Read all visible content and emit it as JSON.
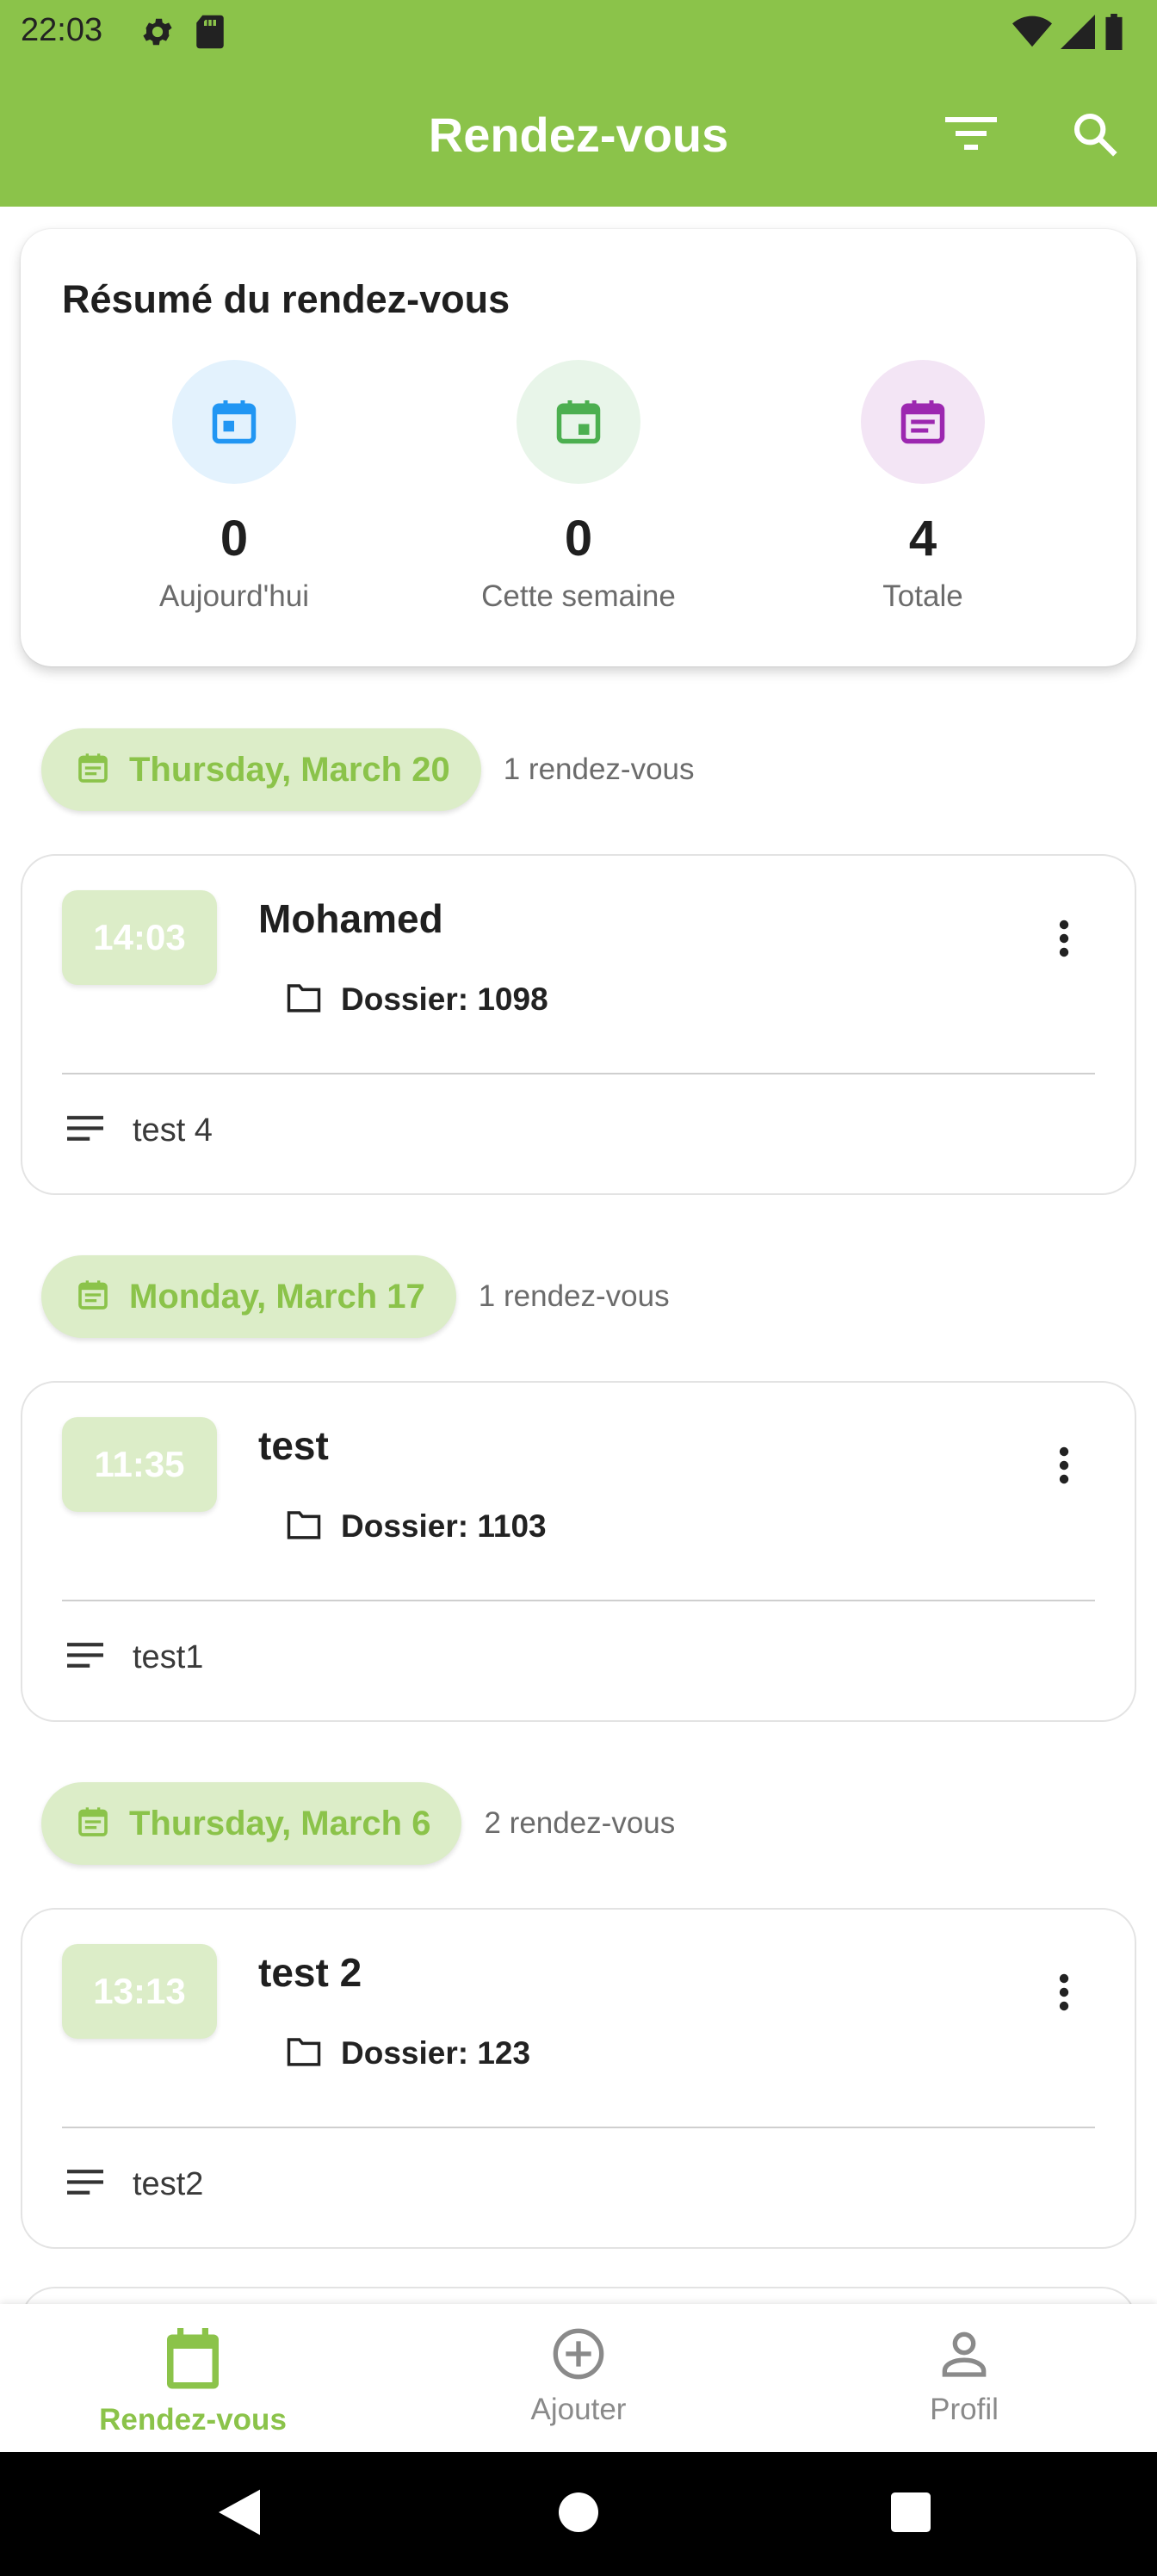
{
  "status_bar": {
    "time": "22:03"
  },
  "app_bar": {
    "title": "Rendez-vous",
    "filter_icon": "filter-icon",
    "search_icon": "search-icon"
  },
  "colors": {
    "primary": "#8bc34a",
    "chip_bg": "#dcedc8",
    "blue": "#2196f3",
    "green": "#4caf50",
    "purple": "#9c27b0"
  },
  "summary": {
    "title": "Résumé du rendez-vous",
    "stats": [
      {
        "value": "0",
        "label": "Aujourd'hui",
        "icon": "calendar-today-icon"
      },
      {
        "value": "0",
        "label": "Cette semaine",
        "icon": "calendar-week-icon"
      },
      {
        "value": "4",
        "label": "Totale",
        "icon": "calendar-total-icon"
      }
    ]
  },
  "groups": [
    {
      "date": "Thursday, March 20",
      "count": "1 rendez-vous",
      "appointment": {
        "time": "14:03",
        "name": "Mohamed",
        "dossier": "Dossier: 1098",
        "note": "test 4"
      }
    },
    {
      "date": "Monday, March 17",
      "count": "1 rendez-vous",
      "appointment": {
        "time": "11:35",
        "name": "test",
        "dossier": "Dossier: 1103",
        "note": "test1"
      }
    },
    {
      "date": "Thursday, March 6",
      "count": "2 rendez-vous",
      "appointment": {
        "time": "13:13",
        "name": "test 2",
        "dossier": "Dossier: 123",
        "note": "test2"
      }
    }
  ],
  "bottom_nav": {
    "items": [
      {
        "label": "Rendez-vous",
        "icon": "calendar-icon",
        "active": true
      },
      {
        "label": "Ajouter",
        "icon": "add-circle-icon",
        "active": false
      },
      {
        "label": "Profil",
        "icon": "person-icon",
        "active": false
      }
    ]
  }
}
